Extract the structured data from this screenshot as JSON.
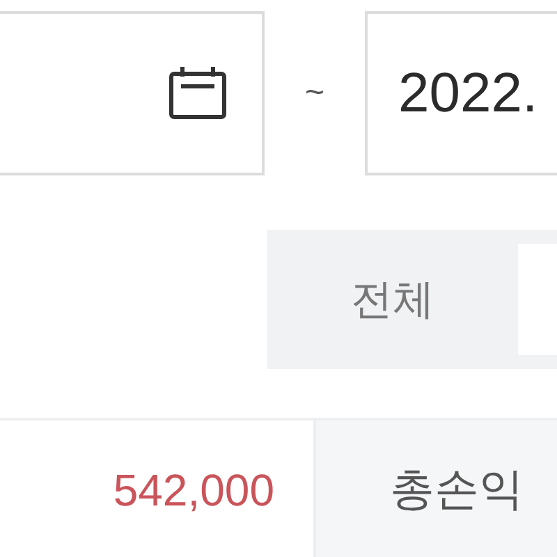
{
  "date_range": {
    "end_value": "2022.",
    "separator": "~"
  },
  "period_tabs": [
    {
      "label": "전체",
      "selected": false
    },
    {
      "selected": true
    }
  ],
  "summary": {
    "value": "542,000",
    "label": "총손익"
  }
}
